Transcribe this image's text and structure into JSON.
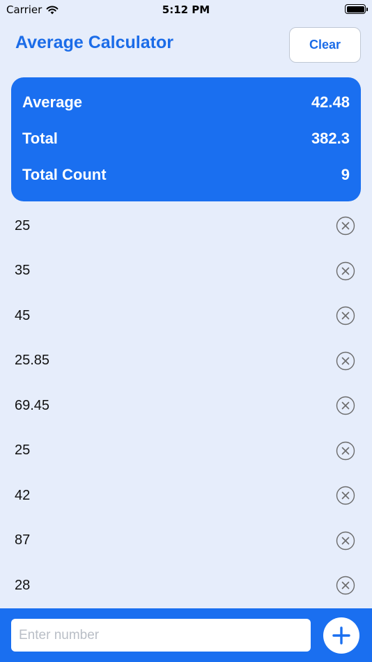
{
  "status_bar": {
    "carrier": "Carrier",
    "time": "5:12 PM"
  },
  "header": {
    "title": "Average Calculator",
    "clear_label": "Clear"
  },
  "summary": {
    "rows": [
      {
        "label": "Average",
        "value": "42.48"
      },
      {
        "label": "Total",
        "value": "382.3"
      },
      {
        "label": "Total Count",
        "value": "9"
      }
    ]
  },
  "numbers": [
    "25",
    "35",
    "45",
    "25.85",
    "69.45",
    "25",
    "42",
    "87",
    "28"
  ],
  "input": {
    "placeholder": "Enter number"
  },
  "colors": {
    "accent": "#1A6FF0",
    "title": "#1B6CE8",
    "background": "#E6EDFB"
  },
  "icons": {
    "remove": "x-circle-icon",
    "add": "plus-icon",
    "wifi": "wifi-icon",
    "battery": "battery-icon"
  }
}
